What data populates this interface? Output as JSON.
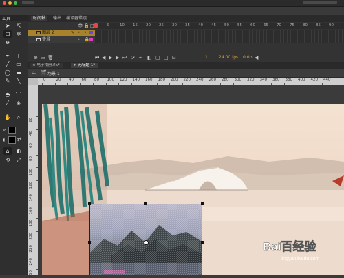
{
  "toolpanel": {
    "title": "工具"
  },
  "timeline": {
    "tabs": [
      "时间轴",
      "输出",
      "编译器错误"
    ],
    "frame_numbers": [
      "1",
      "5",
      "10",
      "15",
      "20",
      "25",
      "30",
      "35",
      "40",
      "45",
      "50",
      "55",
      "60",
      "65",
      "70",
      "75",
      "80",
      "85",
      "90"
    ],
    "layers": [
      {
        "name": "图层 2",
        "active": true
      },
      {
        "name": "背景",
        "active": false
      }
    ],
    "current_frame": "1",
    "fps": "24.00 fps",
    "time": "0.0 s"
  },
  "doc_tabs": [
    "电子相册.fla*",
    "无标题-1*"
  ],
  "scene": {
    "label": "场景 1"
  },
  "hruler_numbers": [
    "0",
    "20",
    "40",
    "60",
    "80",
    "100",
    "120",
    "140",
    "160",
    "180",
    "200",
    "220",
    "240",
    "260",
    "280",
    "300",
    "320",
    "340",
    "360",
    "380",
    "400",
    "420",
    "440"
  ],
  "vruler_numbers": [
    "20",
    "40",
    "60",
    "80",
    "100",
    "120",
    "140",
    "160",
    "180",
    "200",
    "220",
    "240",
    "260"
  ],
  "watermark": {
    "text": "Bai百经验",
    "url": "jingyan.baidu.com"
  },
  "colors": {
    "layer_active": "#a9822c",
    "playhead": "#e64545",
    "guide": "#7fd8e8"
  }
}
